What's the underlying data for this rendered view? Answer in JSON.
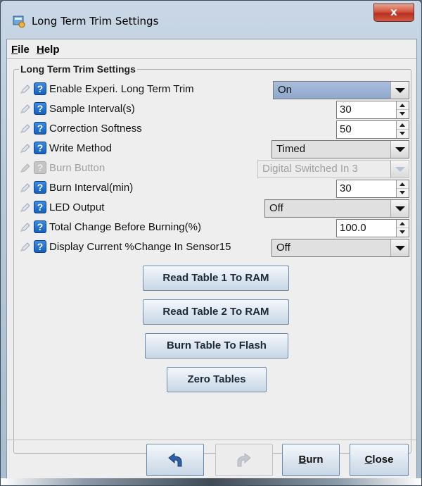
{
  "window": {
    "title": "Long Term Trim Settings",
    "close_glyph": "x"
  },
  "menu": {
    "file": {
      "mnemonic": "F",
      "rest": "ile"
    },
    "help": {
      "mnemonic": "H",
      "rest": "elp"
    }
  },
  "group": {
    "title": "Long Term Trim Settings"
  },
  "rows": [
    {
      "label": "Enable Experi. Long Term Trim",
      "type": "combo",
      "value": "On",
      "enabled": true
    },
    {
      "label": "Sample Interval(s)",
      "type": "spinner",
      "value": "30",
      "enabled": true
    },
    {
      "label": "Correction Softness",
      "type": "spinner",
      "value": "50",
      "enabled": true
    },
    {
      "label": "Write Method",
      "type": "combo",
      "value": "Timed",
      "enabled": true
    },
    {
      "label": "Burn Button",
      "type": "combo",
      "value": "Digital Switched In 3",
      "enabled": false
    },
    {
      "label": "Burn Interval(min)",
      "type": "spinner",
      "value": "30",
      "enabled": true
    },
    {
      "label": "LED Output",
      "type": "combo",
      "value": "Off",
      "enabled": true
    },
    {
      "label": "Total Change Before Burning(%)",
      "type": "spinner",
      "value": "100.0",
      "enabled": true
    },
    {
      "label": "Display Current %Change In Sensor15",
      "type": "combo",
      "value": "Off",
      "enabled": true
    }
  ],
  "help_glyph": "?",
  "actions": {
    "read_table_1": "Read Table 1 To RAM",
    "read_table_2": "Read Table 2 To RAM",
    "burn_flash": "Burn Table To Flash",
    "zero_tables": "Zero Tables"
  },
  "footer": {
    "burn": {
      "mnemonic": "B",
      "rest": "urn"
    },
    "close": {
      "mnemonic": "C",
      "rest": "lose"
    }
  },
  "colors": {
    "help_blue": "#1560c4",
    "close_red": "#c7432c",
    "selected_combo": "#8ea8cb"
  }
}
